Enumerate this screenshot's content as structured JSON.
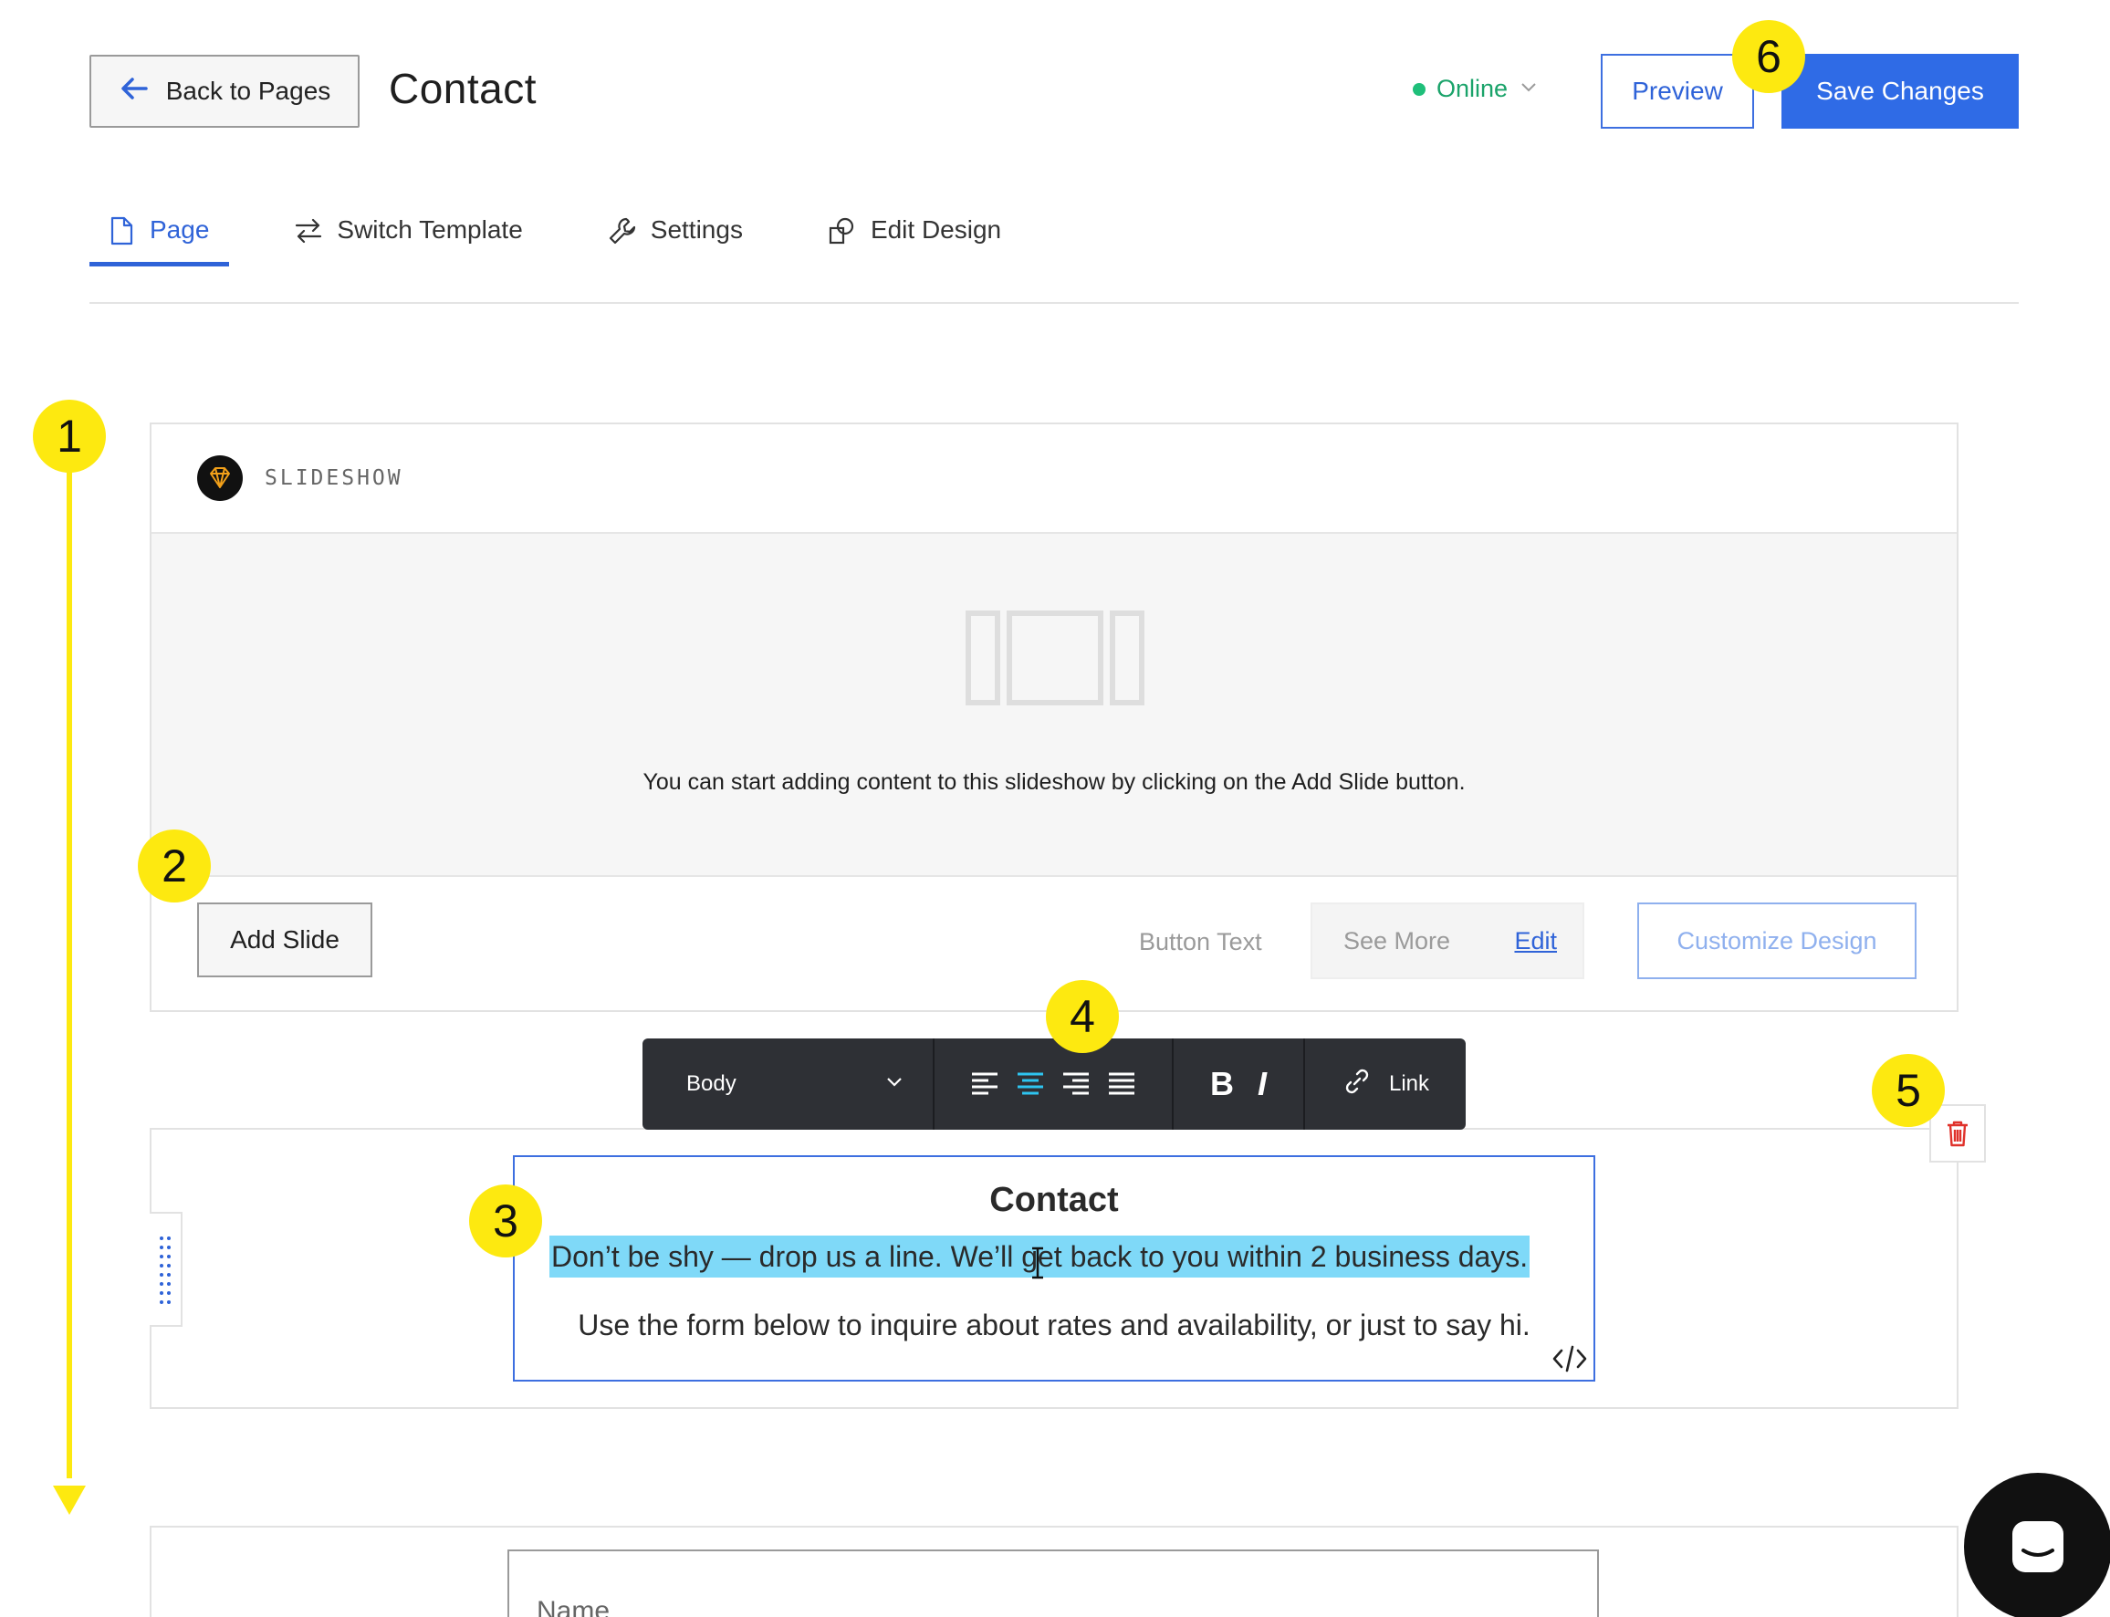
{
  "header": {
    "back_label": "Back to Pages",
    "page_title": "Contact",
    "status": "Online",
    "preview_label": "Preview",
    "save_label": "Save Changes"
  },
  "tabs": [
    {
      "label": "Page",
      "icon": "page-icon",
      "active": true
    },
    {
      "label": "Switch Template",
      "icon": "switch-icon",
      "active": false
    },
    {
      "label": "Settings",
      "icon": "wrench-icon",
      "active": false
    },
    {
      "label": "Edit Design",
      "icon": "design-icon",
      "active": false
    }
  ],
  "annotations": [
    "1",
    "2",
    "3",
    "4",
    "5",
    "6"
  ],
  "slideshow": {
    "label": "SLIDESHOW",
    "empty_message": "You can start adding content to this slideshow by clicking on the Add Slide button.",
    "add_slide_label": "Add Slide",
    "button_text_label": "Button Text",
    "button_text_value": "See More",
    "edit_label": "Edit",
    "customize_label": "Customize Design"
  },
  "toolbar": {
    "style_value": "Body",
    "bold": "B",
    "italic": "I",
    "link_label": "Link",
    "active_alignment": "center"
  },
  "text_block": {
    "heading": "Contact",
    "line1": "Don’t be shy — drop us a line. We’ll get back to you within 2 business days.",
    "line2": "Use the form below to inquire about rates and availability, or just to say hi."
  },
  "form": {
    "name_placeholder": "Name"
  },
  "colors": {
    "accent": "#2f6be6",
    "online": "#1fbf7a",
    "annotation": "#fde910",
    "highlight": "#7fd9f8",
    "toolbar_bg": "#2e3035",
    "delete": "#e0322b"
  }
}
